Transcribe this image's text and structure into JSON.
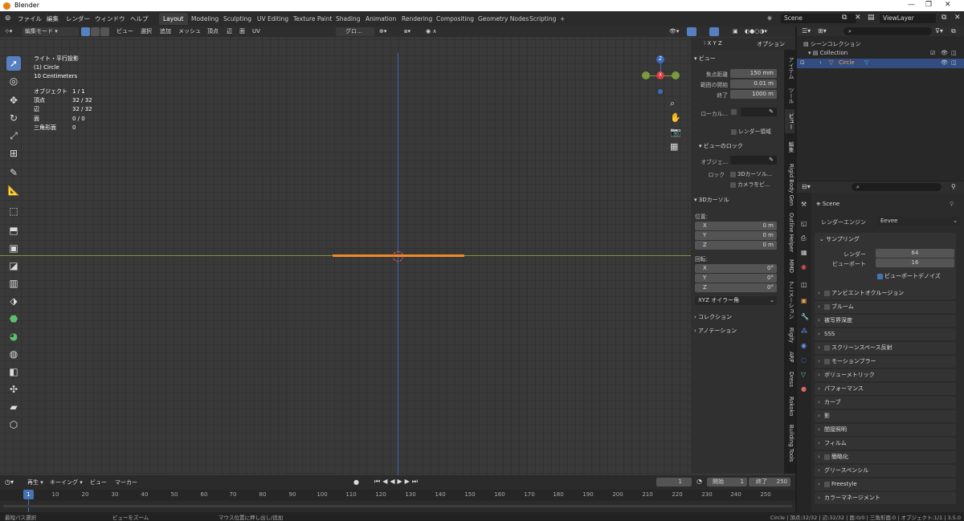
{
  "title": "Blender",
  "menu": [
    "ファイル",
    "編集",
    "レンダー",
    "ウィンドウ",
    "ヘルプ"
  ],
  "workspaces": [
    "Layout",
    "Modeling",
    "Sculpting",
    "UV Editing",
    "Texture Paint",
    "Shading",
    "Animation",
    "Rendering",
    "Compositing",
    "Geometry Nodes",
    "Scripting",
    "+"
  ],
  "scene": "Scene",
  "viewlayer": "ViewLayer",
  "header3d": {
    "mode": "編集モード",
    "menus": [
      "ビュー",
      "選択",
      "追加",
      "メッシュ",
      "頂点",
      "辺",
      "面",
      "UV"
    ],
    "transform": "グロ...",
    "options": "オプション"
  },
  "info": {
    "line1": "ライト・平行投影",
    "line2": "(1) Circle",
    "line3": "10 Centimeters"
  },
  "stats": [
    [
      "オブジェクト",
      "1 / 1"
    ],
    [
      "頂点",
      "32 / 32"
    ],
    [
      "辺",
      "32 / 32"
    ],
    [
      "面",
      "0 / 0"
    ],
    [
      "三角形面",
      "0"
    ]
  ],
  "gizmo": {
    "z": "Z",
    "x": "X"
  },
  "npanel": {
    "view_header": "ビュー",
    "focal_label": "焦点距離",
    "focal": "150 mm",
    "clip_start_label": "範囲の開始",
    "clip_start": "0.01 m",
    "clip_end_label": "終了",
    "clip_end": "1000 m",
    "local_label": "ローカル...",
    "render_region": "レンダー領域",
    "lock_header": "ビューのロック",
    "lock_obj_label": "オブジェ...",
    "lock_label": "ロック",
    "lock_3dcursor": "3Dカーソル...",
    "lock_camera": "カメラをビ...",
    "cursor_header": "3Dカーソル",
    "location": "位置:",
    "x": "X",
    "y": "Y",
    "z": "Z",
    "xv": "0 m",
    "yv": "0 m",
    "zv": "0 m",
    "rotation": "回転:",
    "rx": "0°",
    "ry": "0°",
    "rz": "0°",
    "rot_mode": "XYZ オイラー角",
    "collection": "コレクション",
    "annotation": "アノテーション"
  },
  "ntabs": [
    "アイテム",
    "ツール",
    "ビュー",
    "編集",
    "Rigid Body Gen",
    "Outline Helper",
    "MMD",
    "アニメーション",
    "Rigify",
    "ARP",
    "Dress",
    "Rokoko",
    "Building Tools"
  ],
  "timeline": {
    "menus": [
      "再生",
      "キーイング",
      "ビュー",
      "マーカー"
    ],
    "current": "1",
    "start_label": "開始",
    "start": "1",
    "end_label": "終了",
    "end": "250",
    "ticks": [
      "1",
      "10",
      "20",
      "30",
      "40",
      "50",
      "60",
      "70",
      "80",
      "90",
      "100",
      "110",
      "120",
      "130",
      "140",
      "150",
      "160",
      "170",
      "180",
      "190",
      "200",
      "210",
      "220",
      "230",
      "240",
      "250"
    ]
  },
  "outliner": {
    "scene_collection": "シーンコレクション",
    "collection": "Collection",
    "object": "Circle"
  },
  "props": {
    "scene": "Scene",
    "engine_label": "レンダーエンジン",
    "engine": "Eevee",
    "sampling": "サンプリング",
    "render_label": "レンダー",
    "render_val": "64",
    "viewport_label": "ビューポート",
    "viewport_val": "16",
    "denoise": "ビューポートデノイズ",
    "sections": [
      "アンビエントオクルージョン",
      "ブルーム",
      "被写界深度",
      "SSS",
      "スクリーンスペース反射",
      "モーションブラー",
      "ボリューメトリック",
      "パフォーマンス",
      "カーブ",
      "影",
      "間接照明",
      "フィルム",
      "簡略化",
      "グリースペンシル",
      "Freestyle",
      "カラーマネージメント"
    ]
  },
  "status": {
    "left1": "最短パス選択",
    "left2": "ビューをズーム",
    "left3": "マウス位置に押し出し/追加",
    "right": "Circle | 頂点:32/32 | 辺:32/32 | 面:0/0 | 三角形面:0 | オブジェクト:1/1 | 3.5.0"
  },
  "colors": {
    "accent": "#5680c2",
    "xaxis": "#7a9a3c",
    "yaxis": "#3b6bbf",
    "selected": "#f08a24"
  }
}
